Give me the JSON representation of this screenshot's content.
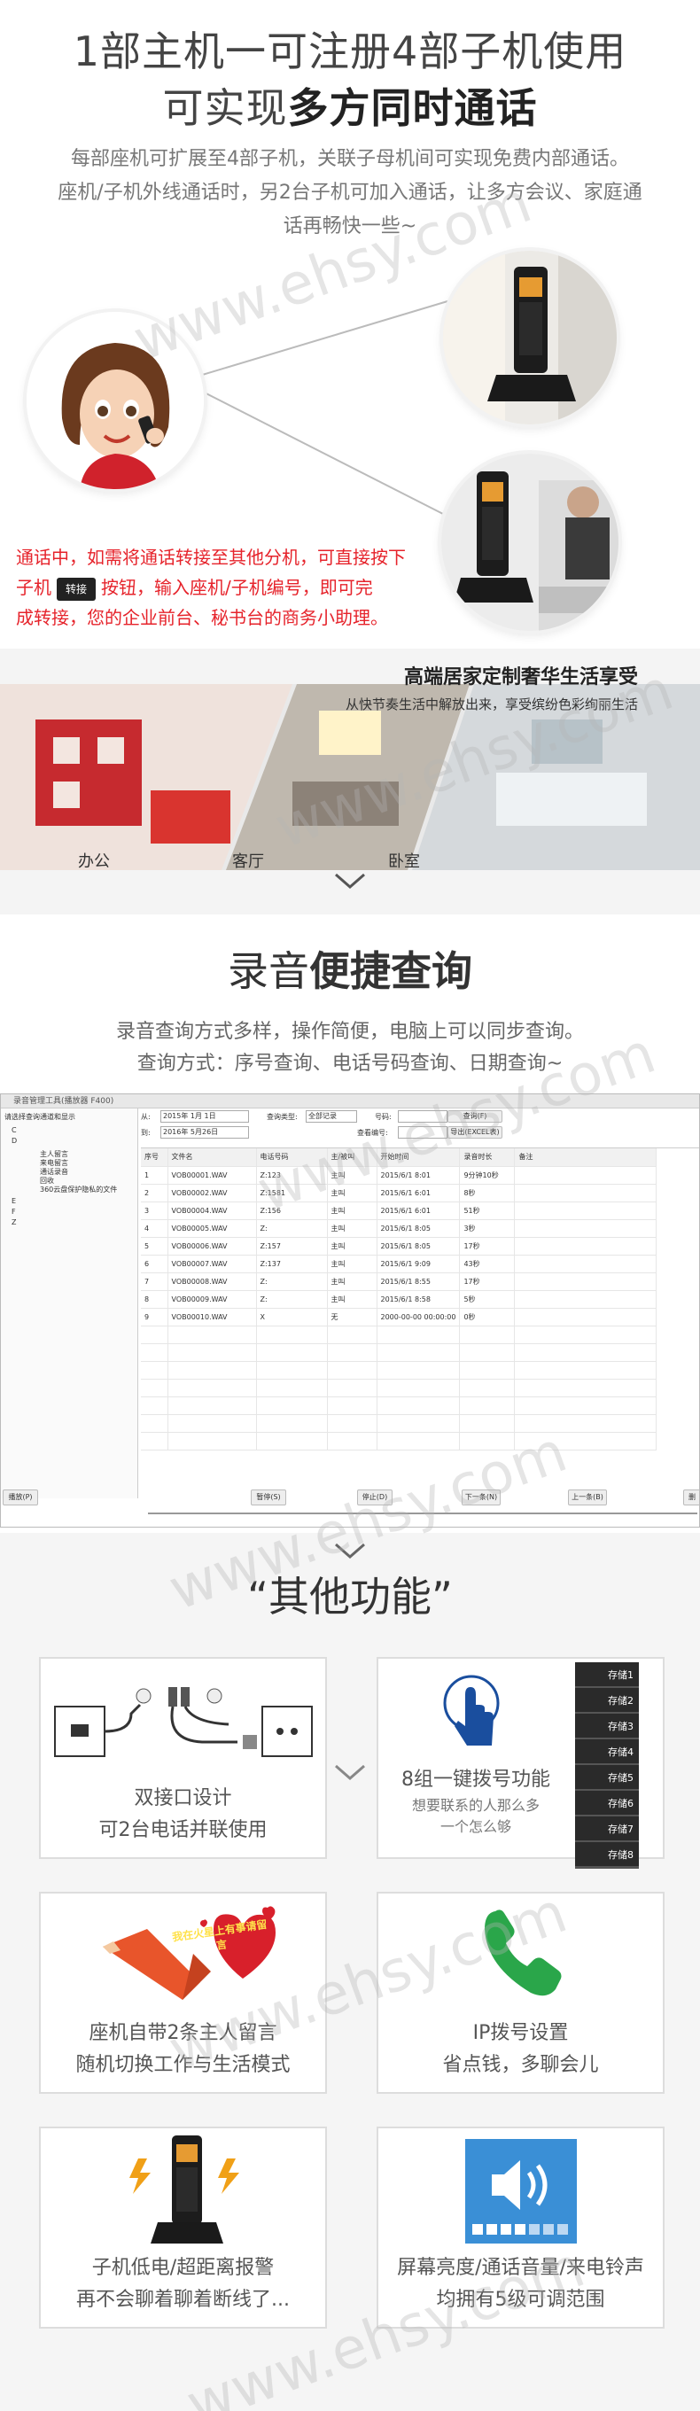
{
  "section1": {
    "title_line1": "1部主机一可注册4部子机使用",
    "title_line2_plain": "可实现",
    "title_line2_bold": "多方同时通话",
    "desc_line1": "每部座机可扩展至4部子机，关联子母机间可实现免费内部通话。",
    "desc_line2": "座机/子机外线通话时，另2台子机可加入通话，让多方会议、家庭通",
    "desc_line3": "话再畅快一些~",
    "red_line1": "通话中，如需将通话转接至其他分机，可直接按下",
    "red_line2_a": "子机",
    "red_line2_key": "转接",
    "red_line2_b": "按钮，输入座机/子机编号，即可完",
    "red_line3": "成转接，您的企业前台、秘书台的商务小助理。"
  },
  "banner": {
    "title": "高端居家定制奢华生活享受",
    "subtitle": "从快节奏生活中解放出来，享受缤纷色彩绚丽生活",
    "rooms": [
      "办公",
      "客厅",
      "卧室"
    ]
  },
  "section2": {
    "title_plain": "录音",
    "title_bold": "便捷查询",
    "desc_line1": "录音查询方式多样，操作简便，电脑上可以同步查询。",
    "desc_line2": "查询方式：序号查询、电话号码查询、日期查询~"
  },
  "software": {
    "window_title": "录音管理工具(播放器 F400)",
    "tree_header": "请选择查询通道和显示",
    "tree_items": [
      "C",
      "D",
      "主人留言",
      "来电留言",
      "通话录音",
      "回收",
      "360云盘保护隐私的文件",
      "E",
      "F",
      "Z"
    ],
    "filter_from_label": "从:",
    "filter_from_value": "2015年 1月 1日",
    "filter_to_label": "到:",
    "filter_to_value": "2016年 5月26日",
    "filter_type_label": "查询类型:",
    "filter_type_value": "全部记录",
    "filter_number_label": "号码:",
    "filter_seq_label": "查看编号:",
    "btn_query": "查询(F)",
    "btn_export": "导出(EXCEL表)",
    "columns": [
      "序号",
      "文件名",
      "电话号码",
      "主/被叫",
      "开始时间",
      "录音时长",
      "备注"
    ],
    "rows": [
      [
        "1",
        "VOB00001.WAV",
        "Z:123",
        "主叫",
        "2015/6/1 8:01",
        "9分钟10秒",
        ""
      ],
      [
        "2",
        "VOB00002.WAV",
        "Z:1581",
        "主叫",
        "2015/6/1 6:01",
        "8秒",
        ""
      ],
      [
        "3",
        "VOB00004.WAV",
        "Z:156",
        "主叫",
        "2015/6/1 6:01",
        "51秒",
        ""
      ],
      [
        "4",
        "VOB00005.WAV",
        "Z:",
        "主叫",
        "2015/6/1 8:05",
        "3秒",
        ""
      ],
      [
        "5",
        "VOB00006.WAV",
        "Z:157",
        "主叫",
        "2015/6/1 8:05",
        "17秒",
        ""
      ],
      [
        "6",
        "VOB00007.WAV",
        "Z:137",
        "主叫",
        "2015/6/1 9:09",
        "43秒",
        ""
      ],
      [
        "7",
        "VOB00008.WAV",
        "Z:",
        "主叫",
        "2015/6/1 8:55",
        "17秒",
        ""
      ],
      [
        "8",
        "VOB00009.WAV",
        "Z:",
        "主叫",
        "2015/6/1 8:58",
        "5秒",
        ""
      ],
      [
        "9",
        "VOB00010.WAV",
        "X",
        "无",
        "2000-00-00 00:00:00",
        "0秒",
        ""
      ]
    ],
    "btn_play": "播放(P)",
    "btn_pause": "暂停(S)",
    "btn_stop": "停止(D)",
    "btn_next": "下一条(N)",
    "btn_prev": "上一条(B)",
    "btn_delete": "删"
  },
  "section3": {
    "title": "“其他功能”",
    "cards": [
      {
        "line1": "双接口设计",
        "line2": "可2台电话并联使用"
      },
      {
        "line1": "8组一键拨号功能",
        "line2": "想要联系的人那么多",
        "line3": "一个怎么够"
      },
      {
        "line1": "座机自带2条主人留言",
        "line2": "随机切换工作与生活模式",
        "badge": "我在火星上有事请留言"
      },
      {
        "line1": "IP拨号设置",
        "line2": "省点钱，多聊会儿"
      },
      {
        "line1": "子机低电/超距离报警",
        "line2": "再不会聊着聊着断线了..."
      },
      {
        "line1": "屏幕亮度/通话音量/来电铃声",
        "line2": "均拥有5级可调范围"
      }
    ],
    "store_buttons": [
      "存储1",
      "存储2",
      "存储3",
      "存储4",
      "存储5",
      "存储6",
      "存储7",
      "存储8"
    ]
  },
  "watermark": "www.ehsy.com",
  "colors": {
    "accent_red": "#e6232b",
    "green_phone": "#2aa64a",
    "blue_icon": "#1a4e9e",
    "speaker_blue": "#3a8fd6"
  }
}
